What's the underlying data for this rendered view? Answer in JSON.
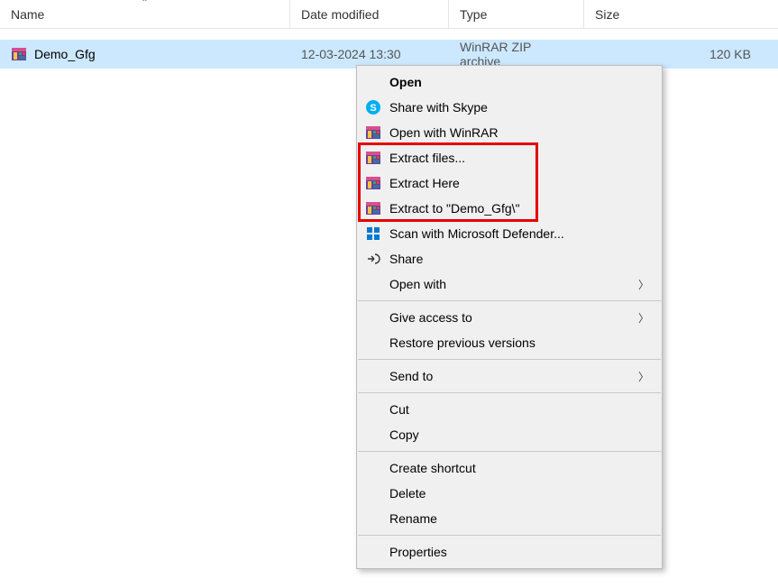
{
  "columns": {
    "name": "Name",
    "date": "Date modified",
    "type": "Type",
    "size": "Size"
  },
  "file": {
    "name": "Demo_Gfg",
    "date": "12-03-2024 13:30",
    "type": "WinRAR ZIP archive",
    "size": "120 KB"
  },
  "menu": {
    "open": "Open",
    "share_skype": "Share with Skype",
    "open_winrar": "Open with WinRAR",
    "extract_files": "Extract files...",
    "extract_here": "Extract Here",
    "extract_to": "Extract to \"Demo_Gfg\\\"",
    "scan_defender": "Scan with Microsoft Defender...",
    "share": "Share",
    "open_with": "Open with",
    "give_access": "Give access to",
    "restore_prev": "Restore previous versions",
    "send_to": "Send to",
    "cut": "Cut",
    "copy": "Copy",
    "create_shortcut": "Create shortcut",
    "delete": "Delete",
    "rename": "Rename",
    "properties": "Properties"
  }
}
